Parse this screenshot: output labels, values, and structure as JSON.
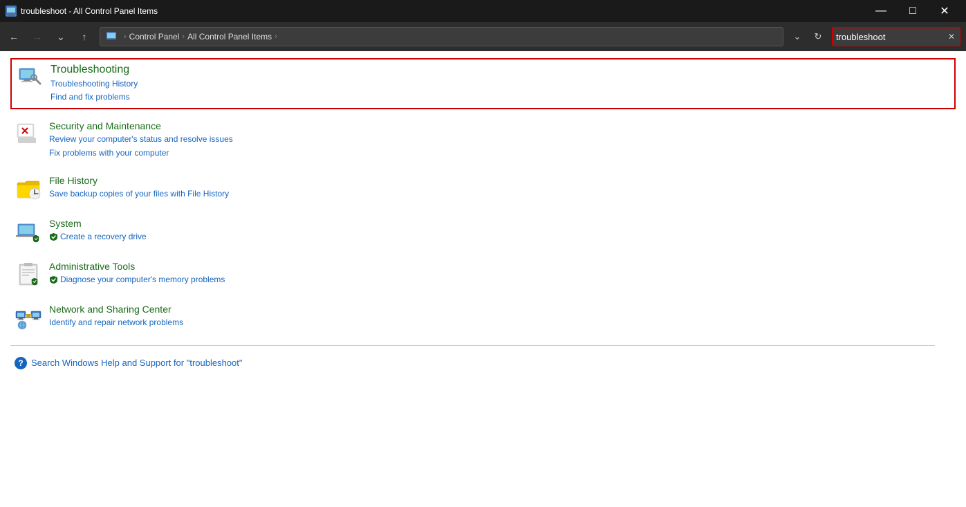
{
  "titlebar": {
    "icon": "control-panel-icon",
    "title": "troubleshoot - All Control Panel Items",
    "minimize_label": "—",
    "maximize_label": "□",
    "close_label": "✕"
  },
  "navbar": {
    "back_label": "←",
    "forward_label": "→",
    "dropdown_label": "⌄",
    "up_label": "↑",
    "address": {
      "segments": [
        "Control Panel",
        "All Control Panel Items"
      ],
      "separator": "›"
    },
    "dropdown2_label": "⌄",
    "refresh_label": "↻",
    "search_value": "troubleshoot",
    "search_clear_label": "✕"
  },
  "results": [
    {
      "id": "troubleshooting",
      "title": "Troubleshooting",
      "highlighted": true,
      "links": [
        "Troubleshooting History",
        "Find and fix problems"
      ]
    },
    {
      "id": "security-maintenance",
      "title": "Security and Maintenance",
      "highlighted": false,
      "links": [
        "Review your computer's status and resolve issues",
        "Fix problems with your computer"
      ]
    },
    {
      "id": "file-history",
      "title": "File History",
      "highlighted": false,
      "links": [
        "Save backup copies of your files with File History"
      ]
    },
    {
      "id": "system",
      "title": "System",
      "highlighted": false,
      "links": [
        "Create a recovery drive"
      ],
      "shield_links": [
        0
      ]
    },
    {
      "id": "administrative-tools",
      "title": "Administrative Tools",
      "highlighted": false,
      "links": [
        "Diagnose your computer's memory problems"
      ],
      "shield_links": [
        0
      ]
    },
    {
      "id": "network-sharing",
      "title": "Network and Sharing Center",
      "highlighted": false,
      "links": [
        "Identify and repair network problems"
      ]
    }
  ],
  "help": {
    "text": "Search Windows Help and Support for \"troubleshoot\""
  }
}
